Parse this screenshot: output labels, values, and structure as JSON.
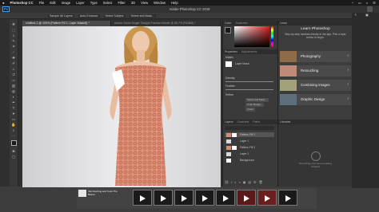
{
  "menubar": {
    "app_name": "Photoshop CC",
    "items": [
      "File",
      "Edit",
      "Image",
      "Layer",
      "Type",
      "Select",
      "Filter",
      "3D",
      "View",
      "Window",
      "Help"
    ]
  },
  "titlebar": {
    "logo": "Ps",
    "title": "Adobe Photoshop CC 2018"
  },
  "options": {
    "items": [
      "Sample All Layers",
      "Auto-Enhance",
      "Select Subject",
      "Select and Mask..."
    ]
  },
  "doc_tabs": [
    {
      "label": "Untitled-1 @ 100% (Pattern Fill 1, Layer Mask/8) *",
      "active": true
    },
    {
      "label": "Adobe Stock Single Straight Fashion Model @ 66.7% (RGB/8) *",
      "active": false
    }
  ],
  "panels": {
    "color_tab": "Color",
    "swatches_tab": "Swatches",
    "properties_tab": "Properties",
    "adjustments_tab": "Adjustments",
    "masks_label": "Masks",
    "layer_mask": "Layer Mask",
    "density_label": "Density:",
    "feather_label": "Feather:",
    "refine_label": "Refine:",
    "select_mask_btn": "Select and Mask...",
    "color_range_btn": "Color Range...",
    "invert_btn": "Invert",
    "layers_tab": "Layers",
    "channels_tab": "Channels",
    "paths_tab": "Paths",
    "layers": [
      "Pattern Fill 1",
      "Layer 1",
      "Pattern Fill 2",
      "Layer 1",
      "Background"
    ]
  },
  "learn": {
    "title": "Learn Photoshop",
    "subtitle": "Step-by-step tutorials directly in the app. Pick a topic below to begin.",
    "items": [
      "Photography",
      "Retouching",
      "Combining Images",
      "Graphic Design"
    ]
  },
  "libraries": {
    "tab": "Libraries",
    "empty_text": "Something went wrong loading Libraries"
  },
  "dock": {
    "item1": "Tab Resizing and Tools The Basics"
  },
  "icons": {
    "ps_logo": "ps-logo-icon",
    "dock_play": "play-icon"
  },
  "colors": {
    "accent": "#31a8ff",
    "dress": "#d4836a",
    "foreground": "#1a1a1a",
    "background": "#ffffff",
    "hue": "#d22020"
  }
}
